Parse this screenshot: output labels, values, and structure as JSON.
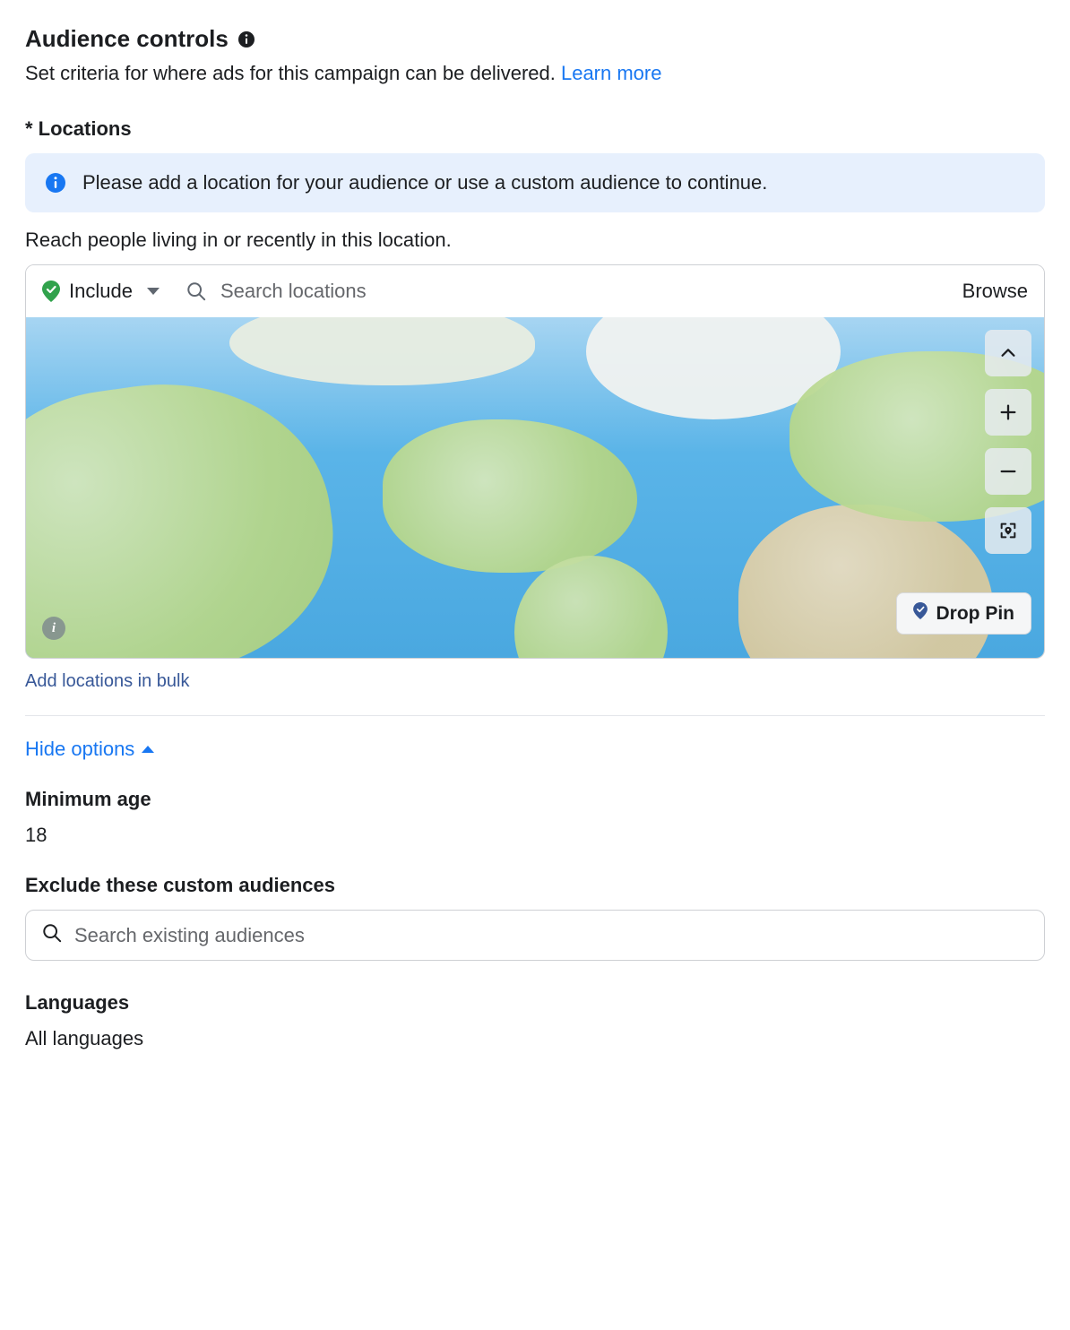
{
  "header": {
    "title": "Audience controls",
    "subtitle_prefix": "Set criteria for where ads for this campaign can be delivered. ",
    "learn_more": "Learn more"
  },
  "locations": {
    "label": "* Locations",
    "banner_text": "Please add a location for your audience or use a custom audience to continue.",
    "reach_text": "Reach people living in or recently in this location.",
    "include_label": "Include",
    "search_placeholder": "Search locations",
    "browse_label": "Browse",
    "drop_pin_label": "Drop Pin",
    "bulk_link": "Add locations in bulk"
  },
  "options": {
    "toggle_label": "Hide options"
  },
  "min_age": {
    "label": "Minimum age",
    "value": "18"
  },
  "exclude": {
    "label": "Exclude these custom audiences",
    "search_placeholder": "Search existing audiences"
  },
  "languages": {
    "label": "Languages",
    "value": "All languages"
  },
  "icons": {
    "info": "info-icon",
    "banner_info": "info-circle-icon",
    "pin": "location-pin-icon",
    "search": "search-icon",
    "caret_down": "chevron-down-icon",
    "caret_up": "chevron-up-icon",
    "zoom_in": "plus-icon",
    "zoom_out": "minus-icon",
    "locate": "target-pin-icon",
    "map_info": "map-info-icon"
  },
  "colors": {
    "link": "#1877f2",
    "banner_bg": "#e7f0fd",
    "banner_icon": "#1877f2",
    "include_pin": "#31a24c",
    "border": "#ced0d4"
  }
}
